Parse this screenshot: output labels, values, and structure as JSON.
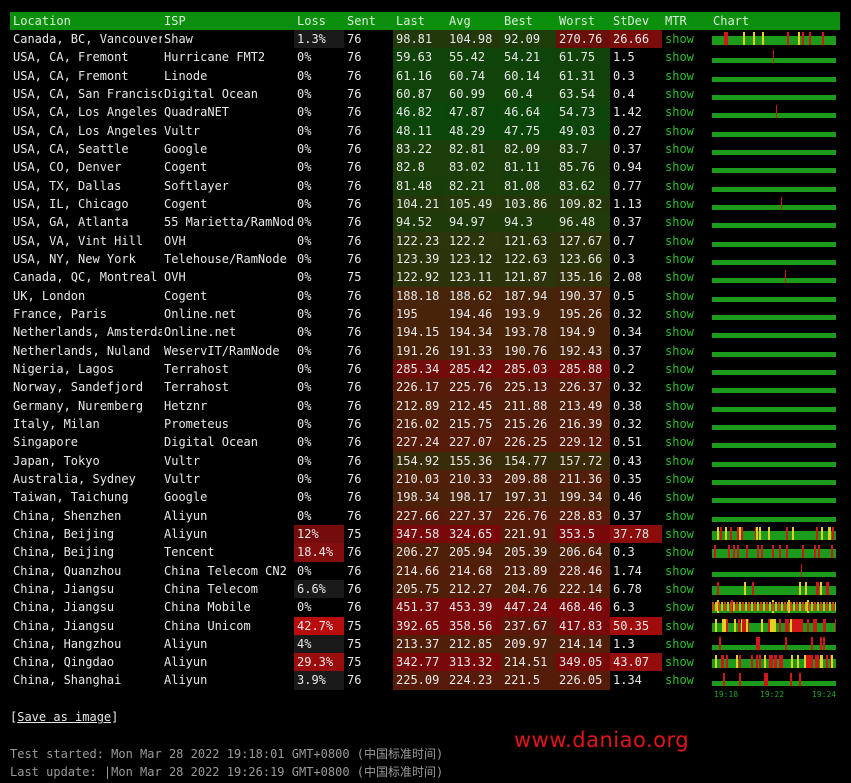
{
  "headers": {
    "location": "Location",
    "isp": "ISP",
    "loss": "Loss",
    "sent": "Sent",
    "last": "Last",
    "avg": "Avg",
    "best": "Best",
    "worst": "Worst",
    "stdev": "StDev",
    "mtr": "MTR",
    "chart": "Chart"
  },
  "rows": [
    {
      "location": "Canada, BC, Vancouver",
      "isp": "Shaw",
      "loss": "1.3%",
      "sent": "76",
      "last": "98.81",
      "avg": "104.98",
      "best": "92.09",
      "worst": "270.76",
      "stdev": "26.66",
      "mtr": "show"
    },
    {
      "location": "USA, CA, Fremont",
      "isp": "Hurricane FMT2",
      "loss": "0%",
      "sent": "76",
      "last": "59.63",
      "avg": "55.42",
      "best": "54.21",
      "worst": "61.75",
      "stdev": "1.5",
      "mtr": "show"
    },
    {
      "location": "USA, CA, Fremont",
      "isp": "Linode",
      "loss": "0%",
      "sent": "76",
      "last": "61.16",
      "avg": "60.74",
      "best": "60.14",
      "worst": "61.31",
      "stdev": "0.3",
      "mtr": "show"
    },
    {
      "location": "USA, CA, San Francisco",
      "isp": "Digital Ocean",
      "loss": "0%",
      "sent": "76",
      "last": "60.87",
      "avg": "60.99",
      "best": "60.4",
      "worst": "63.54",
      "stdev": "0.4",
      "mtr": "show"
    },
    {
      "location": "USA, CA, Los Angeles",
      "isp": "QuadraNET",
      "loss": "0%",
      "sent": "76",
      "last": "46.82",
      "avg": "47.87",
      "best": "46.64",
      "worst": "54.73",
      "stdev": "1.42",
      "mtr": "show"
    },
    {
      "location": "USA, CA, Los Angeles",
      "isp": "Vultr",
      "loss": "0%",
      "sent": "76",
      "last": "48.11",
      "avg": "48.29",
      "best": "47.75",
      "worst": "49.03",
      "stdev": "0.27",
      "mtr": "show"
    },
    {
      "location": "USA, CA, Seattle",
      "isp": "Google",
      "loss": "0%",
      "sent": "76",
      "last": "83.22",
      "avg": "82.81",
      "best": "82.09",
      "worst": "83.7",
      "stdev": "0.37",
      "mtr": "show"
    },
    {
      "location": "USA, CO, Denver",
      "isp": "Cogent",
      "loss": "0%",
      "sent": "76",
      "last": "82.8",
      "avg": "83.02",
      "best": "81.11",
      "worst": "85.76",
      "stdev": "0.94",
      "mtr": "show"
    },
    {
      "location": "USA, TX, Dallas",
      "isp": "Softlayer",
      "loss": "0%",
      "sent": "76",
      "last": "81.48",
      "avg": "82.21",
      "best": "81.08",
      "worst": "83.62",
      "stdev": "0.77",
      "mtr": "show"
    },
    {
      "location": "USA, IL, Chicago",
      "isp": "Cogent",
      "loss": "0%",
      "sent": "76",
      "last": "104.21",
      "avg": "105.49",
      "best": "103.86",
      "worst": "109.82",
      "stdev": "1.13",
      "mtr": "show"
    },
    {
      "location": "USA, GA, Atlanta",
      "isp": "55 Marietta/RamNode",
      "loss": "0%",
      "sent": "76",
      "last": "94.52",
      "avg": "94.97",
      "best": "94.3",
      "worst": "96.48",
      "stdev": "0.37",
      "mtr": "show"
    },
    {
      "location": "USA, VA, Vint Hill",
      "isp": "OVH",
      "loss": "0%",
      "sent": "76",
      "last": "122.23",
      "avg": "122.2",
      "best": "121.63",
      "worst": "127.67",
      "stdev": "0.7",
      "mtr": "show"
    },
    {
      "location": "USA, NY, New York",
      "isp": "Telehouse/RamNode",
      "loss": "0%",
      "sent": "76",
      "last": "123.39",
      "avg": "123.12",
      "best": "122.63",
      "worst": "123.66",
      "stdev": "0.3",
      "mtr": "show"
    },
    {
      "location": "Canada, QC, Montreal",
      "isp": "OVH",
      "loss": "0%",
      "sent": "75",
      "last": "122.92",
      "avg": "123.11",
      "best": "121.87",
      "worst": "135.16",
      "stdev": "2.08",
      "mtr": "show"
    },
    {
      "location": "UK, London",
      "isp": "Cogent",
      "loss": "0%",
      "sent": "76",
      "last": "188.18",
      "avg": "188.62",
      "best": "187.94",
      "worst": "190.37",
      "stdev": "0.5",
      "mtr": "show"
    },
    {
      "location": "France, Paris",
      "isp": "Online.net",
      "loss": "0%",
      "sent": "76",
      "last": "195",
      "avg": "194.46",
      "best": "193.9",
      "worst": "195.26",
      "stdev": "0.32",
      "mtr": "show"
    },
    {
      "location": "Netherlands, Amsterdam",
      "isp": "Online.net",
      "loss": "0%",
      "sent": "76",
      "last": "194.15",
      "avg": "194.34",
      "best": "193.78",
      "worst": "194.9",
      "stdev": "0.34",
      "mtr": "show"
    },
    {
      "location": "Netherlands, Nuland",
      "isp": "WeservIT/RamNode",
      "loss": "0%",
      "sent": "76",
      "last": "191.26",
      "avg": "191.33",
      "best": "190.76",
      "worst": "192.43",
      "stdev": "0.37",
      "mtr": "show"
    },
    {
      "location": "Nigeria, Lagos",
      "isp": "Terrahost",
      "loss": "0%",
      "sent": "76",
      "last": "285.34",
      "avg": "285.42",
      "best": "285.03",
      "worst": "285.88",
      "stdev": "0.2",
      "mtr": "show"
    },
    {
      "location": "Norway, Sandefjord",
      "isp": "Terrahost",
      "loss": "0%",
      "sent": "76",
      "last": "226.17",
      "avg": "225.76",
      "best": "225.13",
      "worst": "226.37",
      "stdev": "0.32",
      "mtr": "show"
    },
    {
      "location": "Germany, Nuremberg",
      "isp": "Hetznr",
      "loss": "0%",
      "sent": "76",
      "last": "212.89",
      "avg": "212.45",
      "best": "211.88",
      "worst": "213.49",
      "stdev": "0.38",
      "mtr": "show"
    },
    {
      "location": "Italy, Milan",
      "isp": "Prometeus",
      "loss": "0%",
      "sent": "76",
      "last": "216.02",
      "avg": "215.75",
      "best": "215.26",
      "worst": "216.39",
      "stdev": "0.32",
      "mtr": "show"
    },
    {
      "location": "Singapore",
      "isp": "Digital Ocean",
      "loss": "0%",
      "sent": "76",
      "last": "227.24",
      "avg": "227.07",
      "best": "226.25",
      "worst": "229.12",
      "stdev": "0.51",
      "mtr": "show"
    },
    {
      "location": "Japan, Tokyo",
      "isp": "Vultr",
      "loss": "0%",
      "sent": "76",
      "last": "154.92",
      "avg": "155.36",
      "best": "154.77",
      "worst": "157.72",
      "stdev": "0.43",
      "mtr": "show"
    },
    {
      "location": "Australia, Sydney",
      "isp": "Vultr",
      "loss": "0%",
      "sent": "76",
      "last": "210.03",
      "avg": "210.33",
      "best": "209.88",
      "worst": "211.36",
      "stdev": "0.35",
      "mtr": "show"
    },
    {
      "location": "Taiwan, Taichung",
      "isp": "Google",
      "loss": "0%",
      "sent": "76",
      "last": "198.34",
      "avg": "198.17",
      "best": "197.31",
      "worst": "199.34",
      "stdev": "0.46",
      "mtr": "show"
    },
    {
      "location": "China, Shenzhen",
      "isp": "Aliyun",
      "loss": "0%",
      "sent": "76",
      "last": "227.66",
      "avg": "227.37",
      "best": "226.76",
      "worst": "228.83",
      "stdev": "0.37",
      "mtr": "show"
    },
    {
      "location": "China, Beijing",
      "isp": "Aliyun",
      "loss": "12%",
      "sent": "75",
      "last": "347.58",
      "avg": "324.65",
      "best": "221.91",
      "worst": "353.5",
      "stdev": "37.78",
      "mtr": "show"
    },
    {
      "location": "China, Beijing",
      "isp": "Tencent",
      "loss": "18.4%",
      "sent": "76",
      "last": "206.27",
      "avg": "205.94",
      "best": "205.39",
      "worst": "206.64",
      "stdev": "0.3",
      "mtr": "show"
    },
    {
      "location": "China, Quanzhou",
      "isp": "China Telecom CN2",
      "loss": "0%",
      "sent": "76",
      "last": "214.66",
      "avg": "214.68",
      "best": "213.89",
      "worst": "228.46",
      "stdev": "1.74",
      "mtr": "show"
    },
    {
      "location": "China, Jiangsu",
      "isp": "China Telecom",
      "loss": "6.6%",
      "sent": "76",
      "last": "205.75",
      "avg": "212.27",
      "best": "204.76",
      "worst": "222.14",
      "stdev": "6.78",
      "mtr": "show"
    },
    {
      "location": "China, Jiangsu",
      "isp": "China Mobile",
      "loss": "0%",
      "sent": "76",
      "last": "451.37",
      "avg": "453.39",
      "best": "447.24",
      "worst": "468.46",
      "stdev": "6.3",
      "mtr": "show"
    },
    {
      "location": "China, Jiangsu",
      "isp": "China Unicom",
      "loss": "42.7%",
      "sent": "75",
      "last": "392.65",
      "avg": "358.56",
      "best": "237.67",
      "worst": "417.83",
      "stdev": "50.35",
      "mtr": "show"
    },
    {
      "location": "China, Hangzhou",
      "isp": "Aliyun",
      "loss": "4%",
      "sent": "75",
      "last": "213.37",
      "avg": "212.85",
      "best": "209.97",
      "worst": "214.14",
      "stdev": "1.3",
      "mtr": "show"
    },
    {
      "location": "China, Qingdao",
      "isp": "Aliyun",
      "loss": "29.3%",
      "sent": "75",
      "last": "342.77",
      "avg": "313.32",
      "best": "214.51",
      "worst": "349.05",
      "stdev": "43.07",
      "mtr": "show"
    },
    {
      "location": "China, Shanghai",
      "isp": "Aliyun",
      "loss": "3.9%",
      "sent": "76",
      "last": "225.09",
      "avg": "224.23",
      "best": "221.5",
      "worst": "226.05",
      "stdev": "1.34",
      "mtr": "show"
    }
  ],
  "chart_ticks": [
    "19:18",
    "19:22",
    "19:24"
  ],
  "save_link": "Save as image",
  "test_started": "Test started: Mon Mar 28 2022 19:18:01 GMT+0800 (中国标准时间)",
  "last_update": "Last update: |Mon Mar 28 2022 19:26:19 GMT+0800 (中国标准时间)",
  "watermark": "www.daniao.org",
  "colors": {
    "header_bg": "#0c8f0c",
    "show": "#2fbe2f",
    "chart_green": "#1c9a1c",
    "loss_red": "#b01010",
    "watermark": "#e0141a"
  }
}
